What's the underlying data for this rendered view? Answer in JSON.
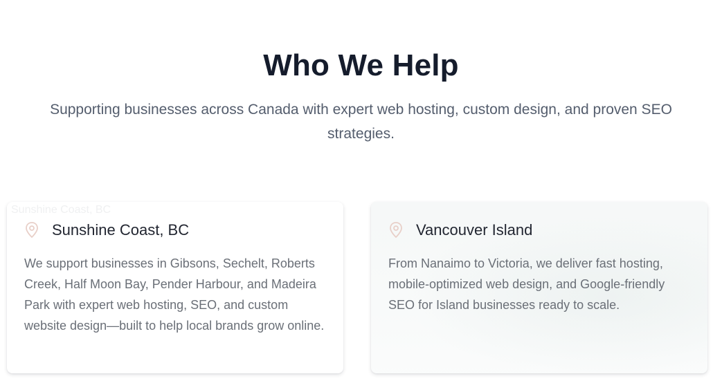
{
  "section": {
    "title": "Who We Help",
    "subtitle": "Supporting businesses across Canada with expert web hosting, custom design, and proven SEO strategies."
  },
  "cards": [
    {
      "image_alt": "Sunshine Coast, BC",
      "icon": "map-pin-icon",
      "title": "Sunshine Coast, BC",
      "description": "We support businesses in Gibsons, Sechelt, Roberts Creek, Half Moon Bay, Pender Harbour, and Madeira Park with expert web hosting, SEO, and custom website design—built to help local brands grow online."
    },
    {
      "icon": "map-pin-icon",
      "title": "Vancouver Island",
      "description": "From Nanaimo to Victoria, we deliver fast hosting, mobile-optimized web design, and Google-friendly SEO for Island businesses ready to scale."
    }
  ],
  "colors": {
    "heading": "#151c2c",
    "subtitle": "#545d6d",
    "icon": "#e8cfc8",
    "body_text": "#6a6f77"
  }
}
